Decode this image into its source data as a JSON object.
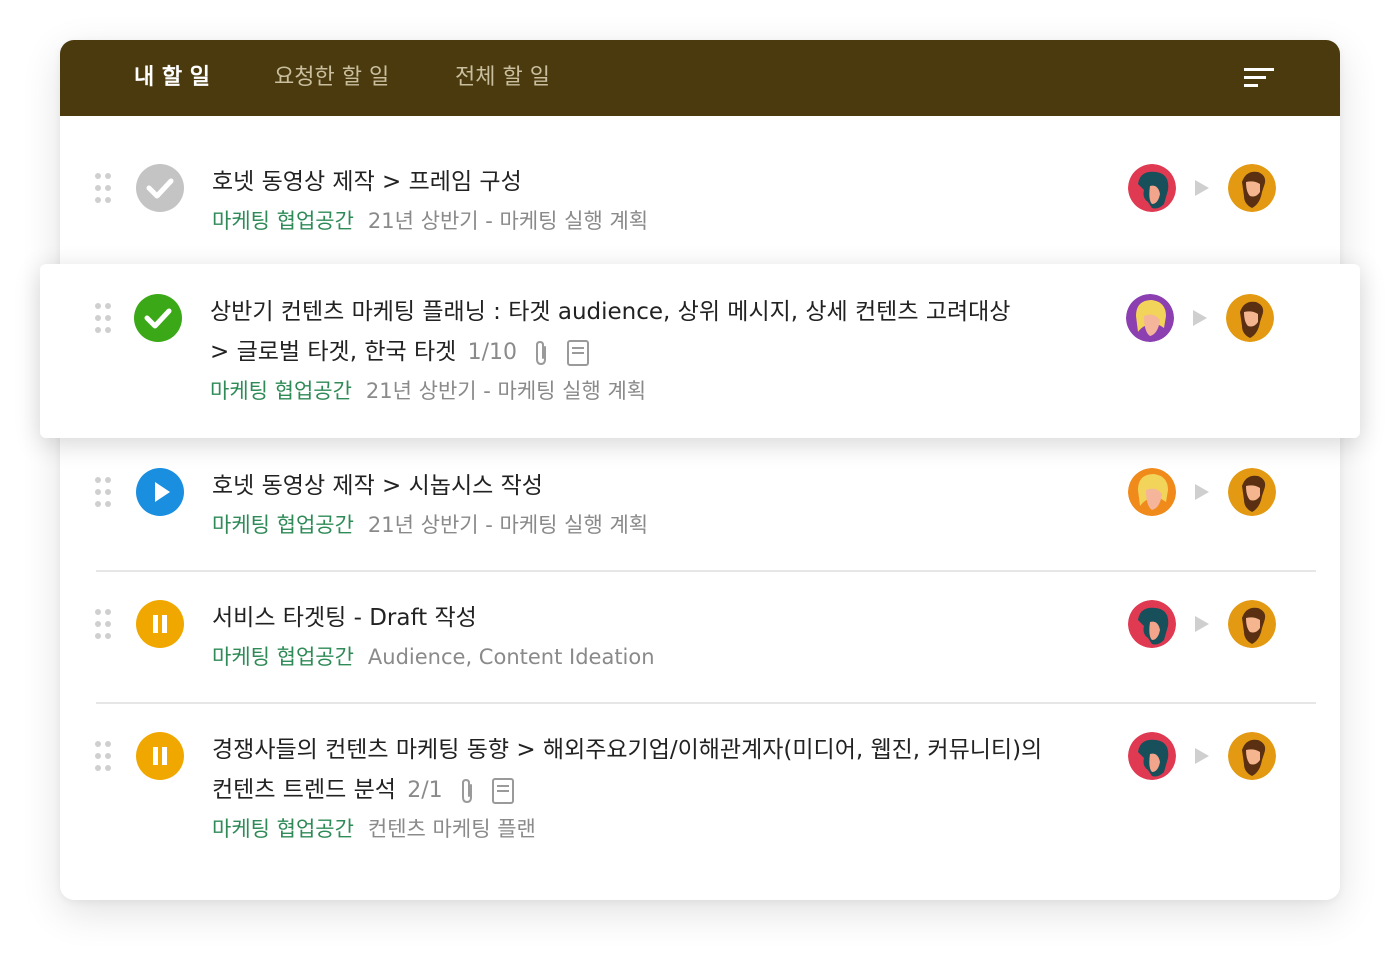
{
  "tabs": [
    {
      "label": "내 할 일",
      "active": true
    },
    {
      "label": "요청한 할 일",
      "active": false
    },
    {
      "label": "전체 할 일",
      "active": false
    }
  ],
  "header_color": "#4a3a0e",
  "menu_icon": "sort-lines-icon",
  "tasks": [
    {
      "status": "done-gray",
      "title_lines": [
        "호넷 동영상 제작 > 프레임 구성"
      ],
      "workspace": "마케팅 협업공간",
      "project": "21년 상반기 - 마케팅 실행 계획",
      "requester": "teal-woman",
      "assignee": "bearded-man"
    },
    {
      "status": "done-green",
      "title_lines": [
        "상반기 컨텐츠 마케팅 플래닝 : 타겟 audience, 상위 메시지, 상세 컨텐츠 고려대상",
        "> 글로벌 타겟, 한국 타겟"
      ],
      "subtask_count": "1/10",
      "workspace": "마케팅 협업공간",
      "project": "21년 상반기 - 마케팅 실행 계획",
      "requester": "blonde-purple",
      "assignee": "bearded-man"
    },
    {
      "status": "in-progress",
      "title_lines": [
        "호넷 동영상 제작 > 시놉시스 작성"
      ],
      "workspace": "마케팅 협업공간",
      "project": "21년 상반기 - 마케팅 실행 계획",
      "requester": "blonde-orange",
      "assignee": "bearded-man"
    },
    {
      "status": "paused",
      "title_lines": [
        "서비스 타겟팅 - Draft 작성"
      ],
      "workspace": "마케팅 협업공간",
      "project": "Audience, Content Ideation",
      "requester": "teal-woman",
      "assignee": "bearded-man"
    },
    {
      "status": "paused",
      "title_lines": [
        "경쟁사들의 컨텐츠 마케팅 동향 > 해외주요기업/이해관계자(미디어, 웹진, 커뮤니티)의",
        "컨텐츠 트렌드 분석"
      ],
      "subtask_count": "2/1",
      "workspace": "마케팅 협업공간",
      "project": "컨텐츠 마케팅 플랜",
      "requester": "teal-woman",
      "assignee": "bearded-man"
    }
  ],
  "colors": {
    "done_gray": "#c4c4c4",
    "done_green": "#3aa817",
    "in_progress": "#1a8fe0",
    "paused": "#f0a800",
    "workspace_text": "#2e8b57"
  }
}
